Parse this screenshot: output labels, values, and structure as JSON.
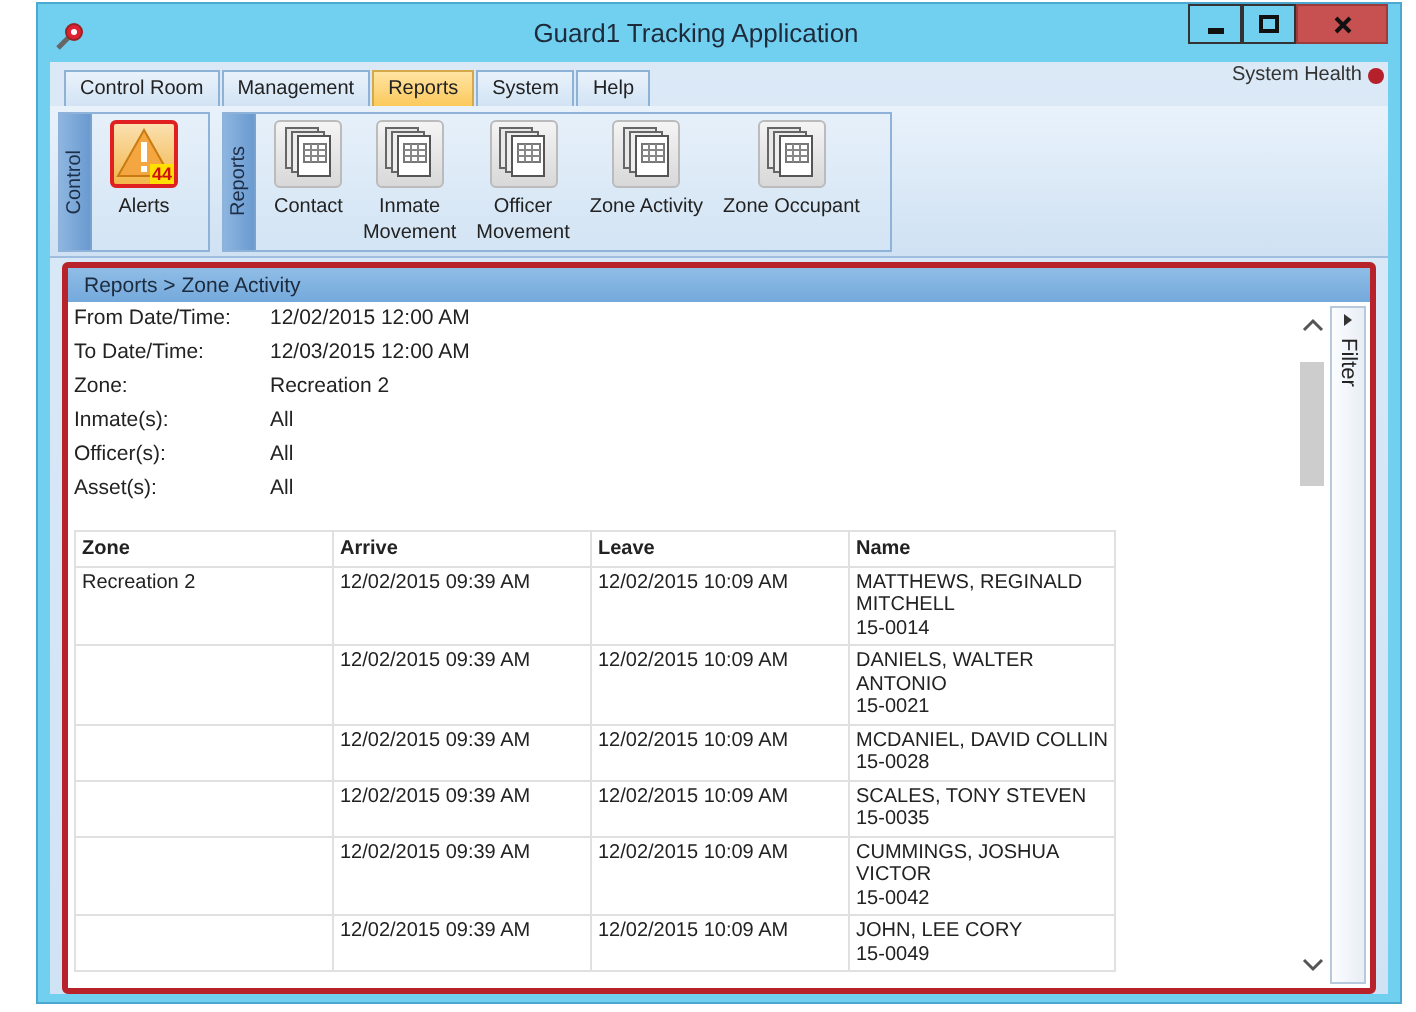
{
  "window": {
    "title": "Guard1 Tracking Application"
  },
  "tabs": [
    {
      "label": "Control Room",
      "selected": false
    },
    {
      "label": "Management",
      "selected": false
    },
    {
      "label": "Reports",
      "selected": true
    },
    {
      "label": "System",
      "selected": false
    },
    {
      "label": "Help",
      "selected": false
    }
  ],
  "system_health": {
    "label": "System Health"
  },
  "ribbon": {
    "groups": [
      {
        "label": "Control",
        "buttons": [
          {
            "label": "Alerts",
            "kind": "alert",
            "badge": "44",
            "selected": true
          }
        ]
      },
      {
        "label": "Reports",
        "buttons": [
          {
            "label": "Contact",
            "kind": "report",
            "selected": false
          },
          {
            "label": "Inmate\nMovement",
            "kind": "report",
            "selected": false
          },
          {
            "label": "Officer\nMovement",
            "kind": "report",
            "selected": false
          },
          {
            "label": "Zone Activity",
            "kind": "report",
            "selected": false
          },
          {
            "label": "Zone Occupant",
            "kind": "report",
            "selected": false
          }
        ]
      }
    ]
  },
  "breadcrumb": "Reports > Zone Activity",
  "criteria": [
    {
      "label": "From Date/Time:",
      "value": "12/02/2015 12:00 AM"
    },
    {
      "label": "To Date/Time:",
      "value": "12/03/2015 12:00 AM"
    },
    {
      "label": "Zone:",
      "value": "Recreation 2"
    },
    {
      "label": "Inmate(s):",
      "value": "All"
    },
    {
      "label": "Officer(s):",
      "value": "All"
    },
    {
      "label": "Asset(s):",
      "value": "All"
    }
  ],
  "table": {
    "columns": [
      "Zone",
      "Arrive",
      "Leave",
      "Name"
    ],
    "rows": [
      [
        "Recreation 2",
        "12/02/2015 09:39 AM",
        "12/02/2015 10:09 AM",
        "MATTHEWS, REGINALD\nMITCHELL\n15-0014"
      ],
      [
        "",
        "12/02/2015 09:39 AM",
        "12/02/2015 10:09 AM",
        "DANIELS, WALTER\nANTONIO\n15-0021"
      ],
      [
        "",
        "12/02/2015 09:39 AM",
        "12/02/2015 10:09 AM",
        "MCDANIEL, DAVID COLLIN\n15-0028"
      ],
      [
        "",
        "12/02/2015 09:39 AM",
        "12/02/2015 10:09 AM",
        "SCALES, TONY STEVEN\n15-0035"
      ],
      [
        "",
        "12/02/2015 09:39 AM",
        "12/02/2015 10:09 AM",
        "CUMMINGS, JOSHUA\nVICTOR\n15-0042"
      ],
      [
        "",
        "12/02/2015 09:39 AM",
        "12/02/2015 10:09 AM",
        "JOHN, LEE CORY\n15-0049"
      ]
    ]
  },
  "filter_panel": {
    "label": "Filter"
  }
}
